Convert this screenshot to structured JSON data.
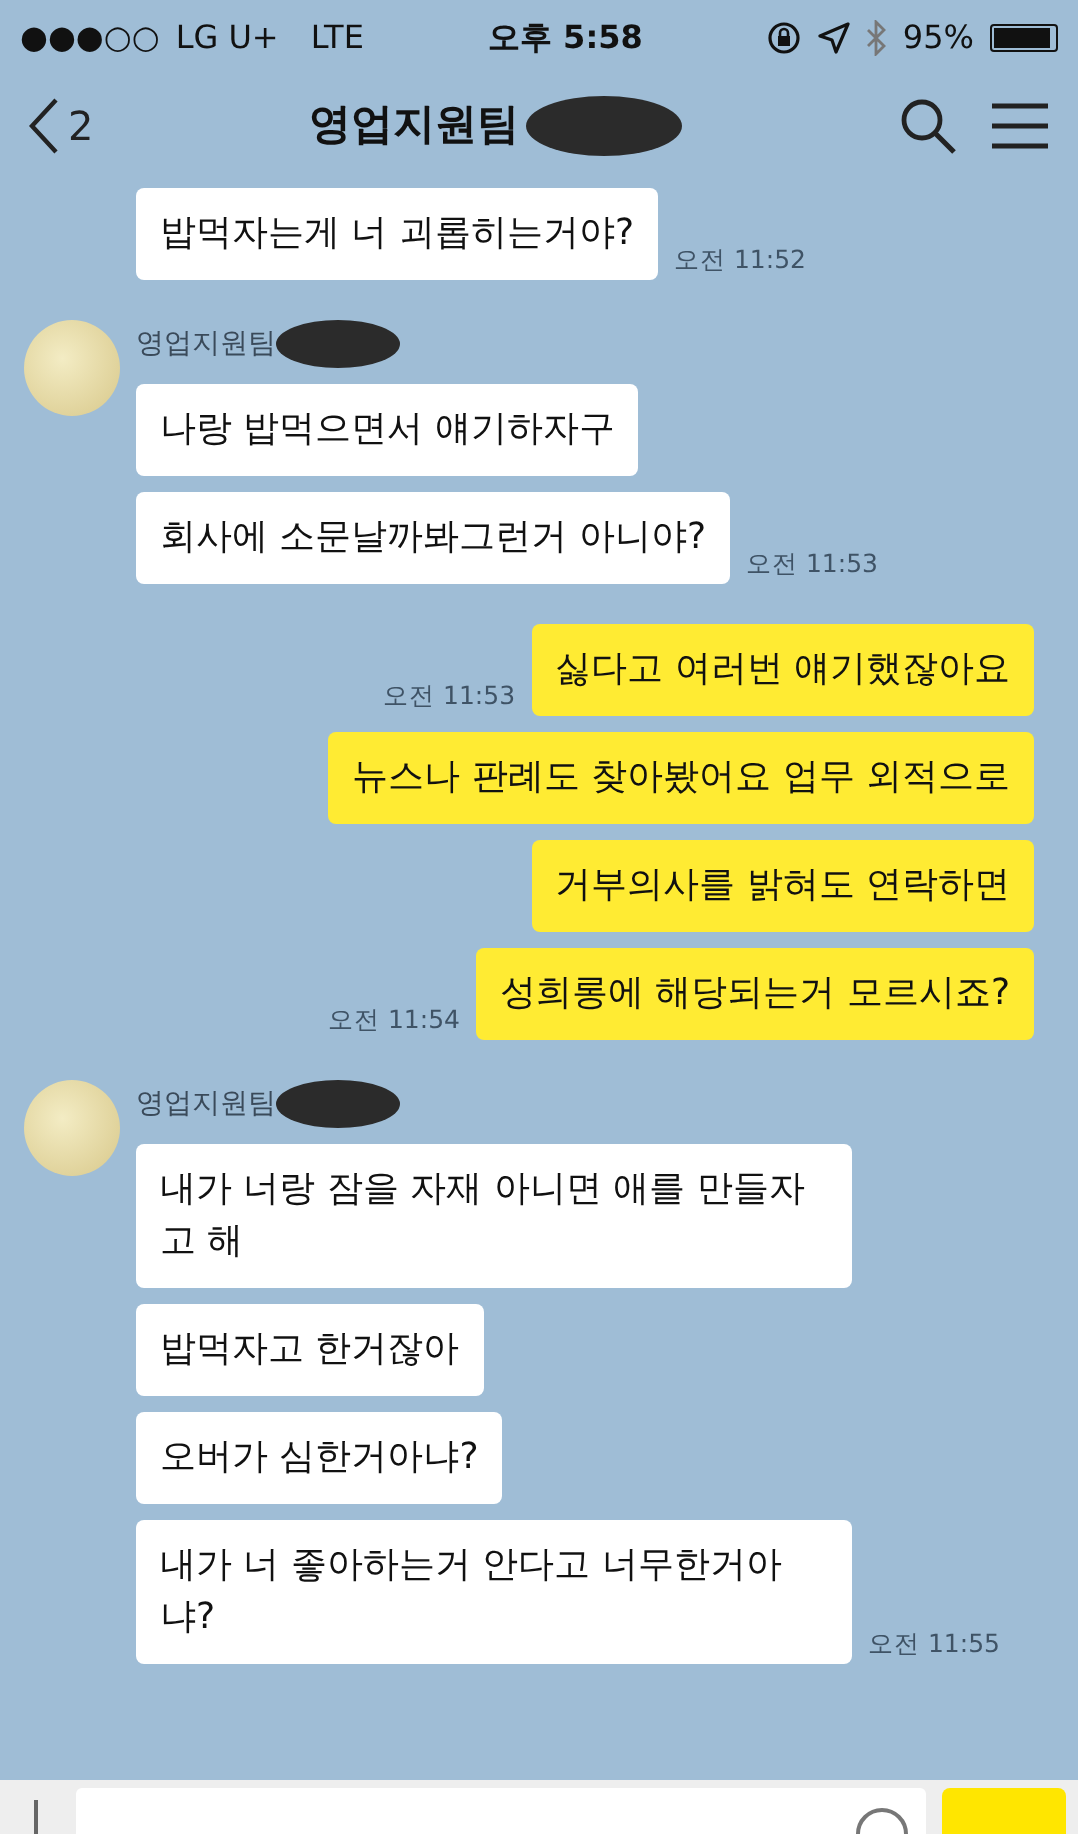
{
  "status_bar": {
    "signal": "●●●○○",
    "carrier": "LG U+",
    "network": "LTE",
    "time": "오후 5:58",
    "battery": "95%"
  },
  "header": {
    "back_count": "2",
    "title": "영업지원팀",
    "redacted": true
  },
  "groups": [
    {
      "kind": "received",
      "messages": [
        {
          "text": "밥먹자는게 너 괴롭히는거야?",
          "time": "오전 11:52"
        }
      ]
    },
    {
      "kind": "received",
      "sender": "영업지원팀",
      "sender_redacted": true,
      "messages": [
        {
          "text": "나랑 밥먹으면서 얘기하자구"
        },
        {
          "text": "회사에 소문날까봐그런거 아니야?",
          "time": "오전 11:53"
        }
      ]
    },
    {
      "kind": "sent",
      "messages": [
        {
          "text": "싫다고 여러번 얘기했잖아요",
          "time": "오전 11:53"
        },
        {
          "text": "뉴스나 판례도 찾아봤어요 업무 외적으로"
        },
        {
          "text": "거부의사를 밝혀도 연락하면"
        },
        {
          "text": "성희롱에 해당되는거 모르시죠?",
          "time": "오전 11:54"
        }
      ]
    },
    {
      "kind": "received",
      "sender": "영업지원팀",
      "sender_redacted": true,
      "messages": [
        {
          "text": "내가 너랑 잠을 자재 아니면 애를 만들자 고 해"
        },
        {
          "text": "밥먹자고 한거잖아"
        },
        {
          "text": "오버가 심한거아냐?"
        },
        {
          "text": "내가 너 좋아하는거 안다고 너무한거아 냐?",
          "time": "오전 11:55"
        }
      ]
    }
  ]
}
